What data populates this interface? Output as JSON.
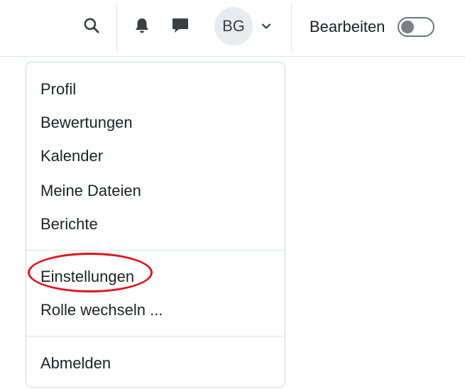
{
  "navbar": {
    "search_icon": "search-icon",
    "notifications_icon": "bell-icon",
    "messages_icon": "chat-icon",
    "avatar_initials": "BG",
    "user_menu_icon": "chevron-down-icon",
    "edit_mode_label": "Bearbeiten",
    "edit_mode_enabled": false
  },
  "user_menu": {
    "group1": [
      "Profil",
      "Bewertungen",
      "Kalender",
      "Meine Dateien",
      "Berichte"
    ],
    "group2": [
      "Einstellungen",
      "Rolle wechseln ..."
    ],
    "group3": [
      "Abmelden"
    ],
    "highlighted_item": "Einstellungen",
    "highlight_color": "#e0161d"
  }
}
